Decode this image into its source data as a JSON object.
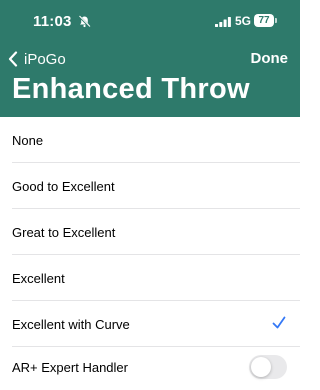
{
  "status_bar": {
    "time": "11:03",
    "network": "5G",
    "battery": "77"
  },
  "nav": {
    "back_label": "iPoGo",
    "done_label": "Done"
  },
  "page": {
    "title": "Enhanced Throw"
  },
  "options": [
    {
      "label": "None",
      "selected": false
    },
    {
      "label": "Good to Excellent",
      "selected": false
    },
    {
      "label": "Great to Excellent",
      "selected": false
    },
    {
      "label": "Excellent",
      "selected": false
    },
    {
      "label": "Excellent with Curve",
      "selected": true
    }
  ],
  "toggle": {
    "label": "AR+ Expert Handler",
    "on": false
  },
  "colors": {
    "header": "#2e7a6b",
    "accent": "#3478f6"
  }
}
